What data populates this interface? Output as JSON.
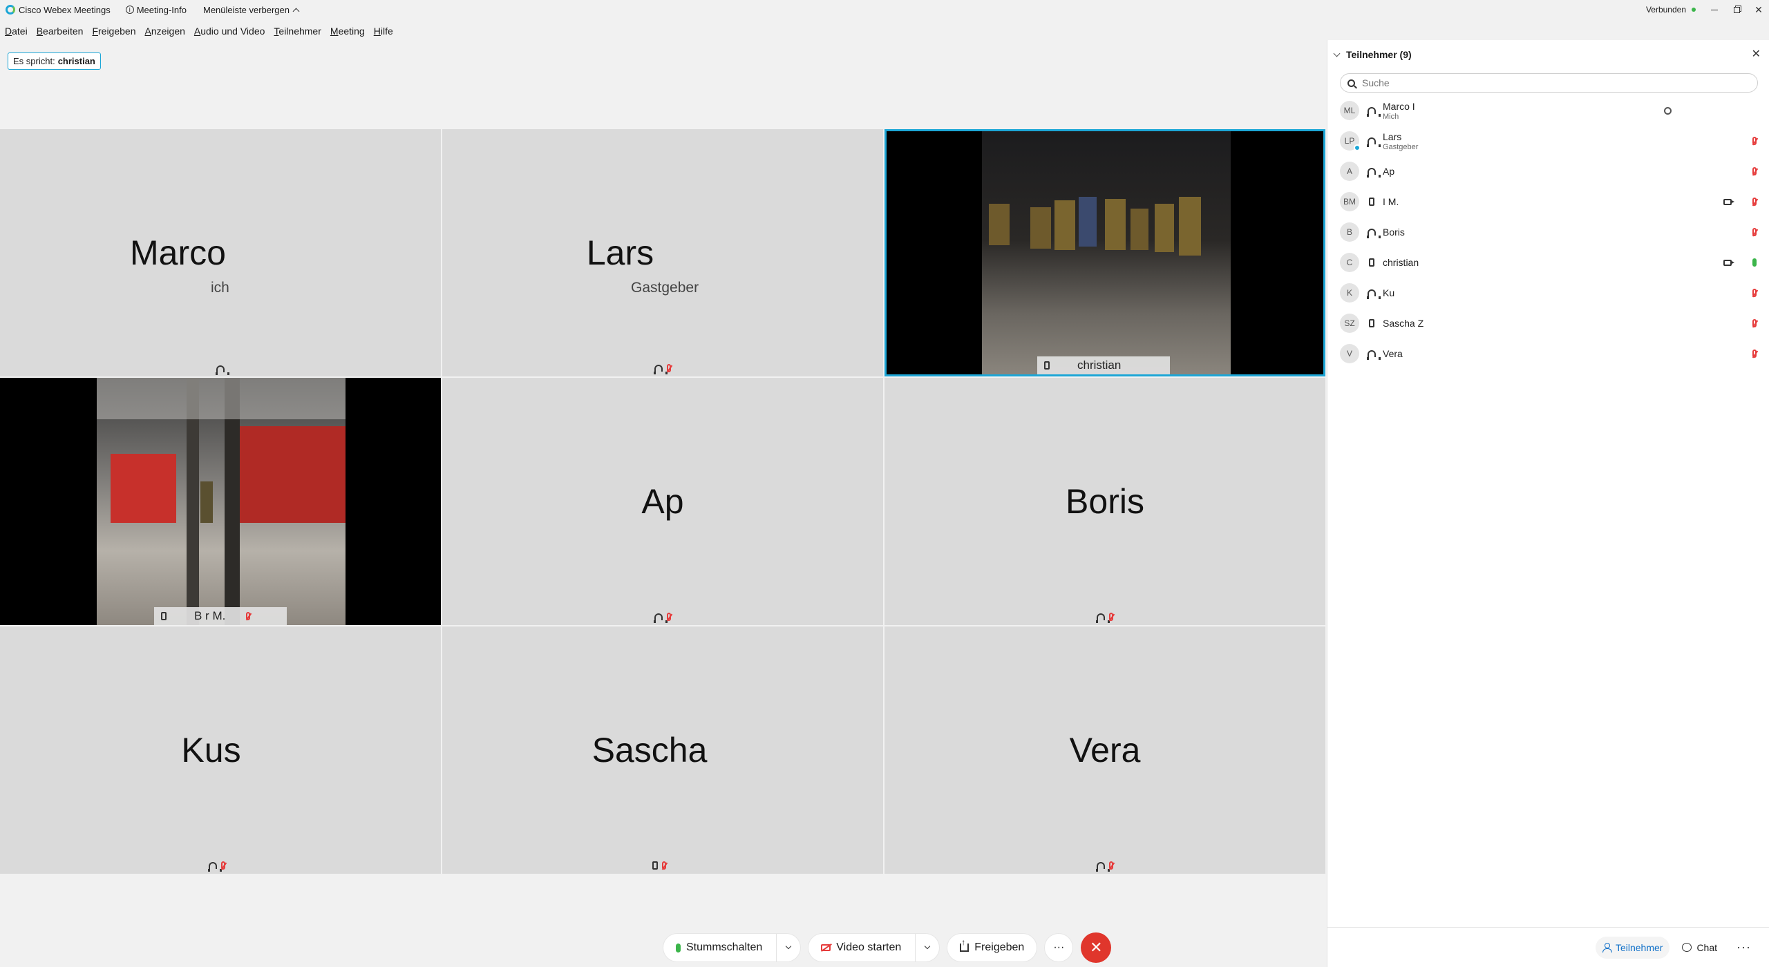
{
  "titlebar": {
    "app_title": "Cisco Webex Meetings",
    "meeting_info": "Meeting-Info",
    "hide_menu": "Menüleiste verbergen",
    "status": "Verbunden",
    "colors": {
      "accent": "#1ca6d6",
      "connected": "#3bb54a",
      "end": "#e0362c",
      "muted": "#e63c3c"
    }
  },
  "menu": [
    "Datei",
    "Bearbeiten",
    "Freigeben",
    "Anzeigen",
    "Audio und Video",
    "Teilnehmer",
    "Meeting",
    "Hilfe"
  ],
  "speaker": {
    "label": "Es spricht:",
    "name": "christian"
  },
  "tiles": {
    "marco": {
      "name": "Marco",
      "sub": "ich"
    },
    "lars": {
      "name": "Lars",
      "sub": "Gastgeber"
    },
    "christian": {
      "label": "christian"
    },
    "bm": {
      "label": "B   r M."
    },
    "ap": {
      "name": "Ap"
    },
    "boris": {
      "name": "Boris"
    },
    "kus": {
      "name": "Kus"
    },
    "sascha": {
      "name": "Sascha"
    },
    "vera": {
      "name": "Vera"
    }
  },
  "panel": {
    "title": "Teilnehmer (9)",
    "search_placeholder": "Suche",
    "participants": [
      {
        "initials": "ML",
        "name": "Marco I",
        "role": "Mich"
      },
      {
        "initials": "LP",
        "name": "Lars",
        "role": "Gastgeber"
      },
      {
        "initials": "A",
        "name": "Ap"
      },
      {
        "initials": "BM",
        "name": "I     M."
      },
      {
        "initials": "B",
        "name": "Boris"
      },
      {
        "initials": "C",
        "name": "christian"
      },
      {
        "initials": "K",
        "name": "Ku"
      },
      {
        "initials": "SZ",
        "name": "Sascha Z"
      },
      {
        "initials": "V",
        "name": "Vera"
      }
    ],
    "bottom": {
      "participants": "Teilnehmer",
      "chat": "Chat"
    }
  },
  "controls": {
    "mute": "Stummschalten",
    "video": "Video starten",
    "share": "Freigeben"
  }
}
